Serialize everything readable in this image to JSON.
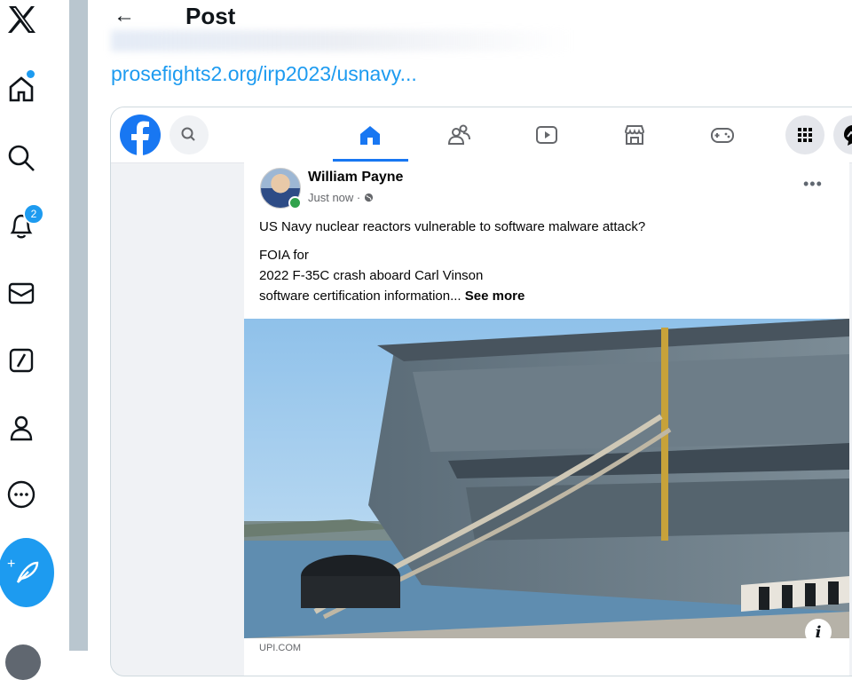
{
  "header": {
    "back_label": "←",
    "title": "Post"
  },
  "tweet": {
    "link_text": "prosefights2.org/irp2023/usnavy..."
  },
  "nav": {
    "notification_count": "2",
    "icons": [
      "x-logo",
      "home",
      "search",
      "notifications",
      "messages",
      "grok",
      "profile",
      "more",
      "compose-post"
    ]
  },
  "facebook": {
    "tabs": [
      "home",
      "friends",
      "watch",
      "marketplace",
      "gaming"
    ],
    "post": {
      "author": "William Payne",
      "meta": "Just now · ",
      "more": "•••",
      "line1": "US Navy nuclear reactors vulnerable to software malware  attack?",
      "line2": "FOIA for",
      "line3": "2022 F-35C crash aboard Carl Vinson",
      "line4": "software certification information...",
      "see_more": "See more",
      "source": "UPI.COM",
      "info_label": "i"
    }
  },
  "colors": {
    "twitter_blue": "#1d9bf0",
    "facebook_blue": "#1877f2",
    "divider": "#b9c6cf"
  }
}
